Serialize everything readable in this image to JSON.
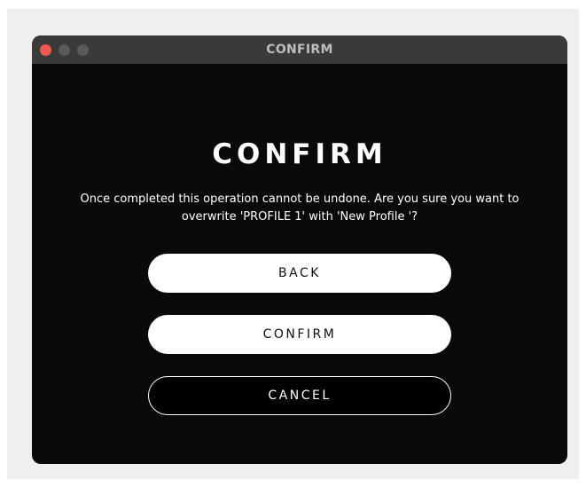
{
  "window": {
    "title": "CONFIRM",
    "controls": {
      "close_icon": "close-icon",
      "minimize_icon": "minimize-icon",
      "zoom_icon": "zoom-icon"
    }
  },
  "dialog": {
    "heading": "CONFIRM",
    "message_line1": "Once completed this operation cannot be undone. Are you sure you want to",
    "message_line2": "overwrite 'PROFILE 1' with 'New Profile '?",
    "buttons": {
      "back": "BACK",
      "confirm": "CONFIRM",
      "cancel": "CANCEL"
    }
  },
  "colors": {
    "background": "#0a0a0a",
    "titlebar": "#3a3a3a",
    "close_button": "#ee5a52",
    "inactive_button": "#5a5a5a",
    "text": "#ffffff"
  }
}
